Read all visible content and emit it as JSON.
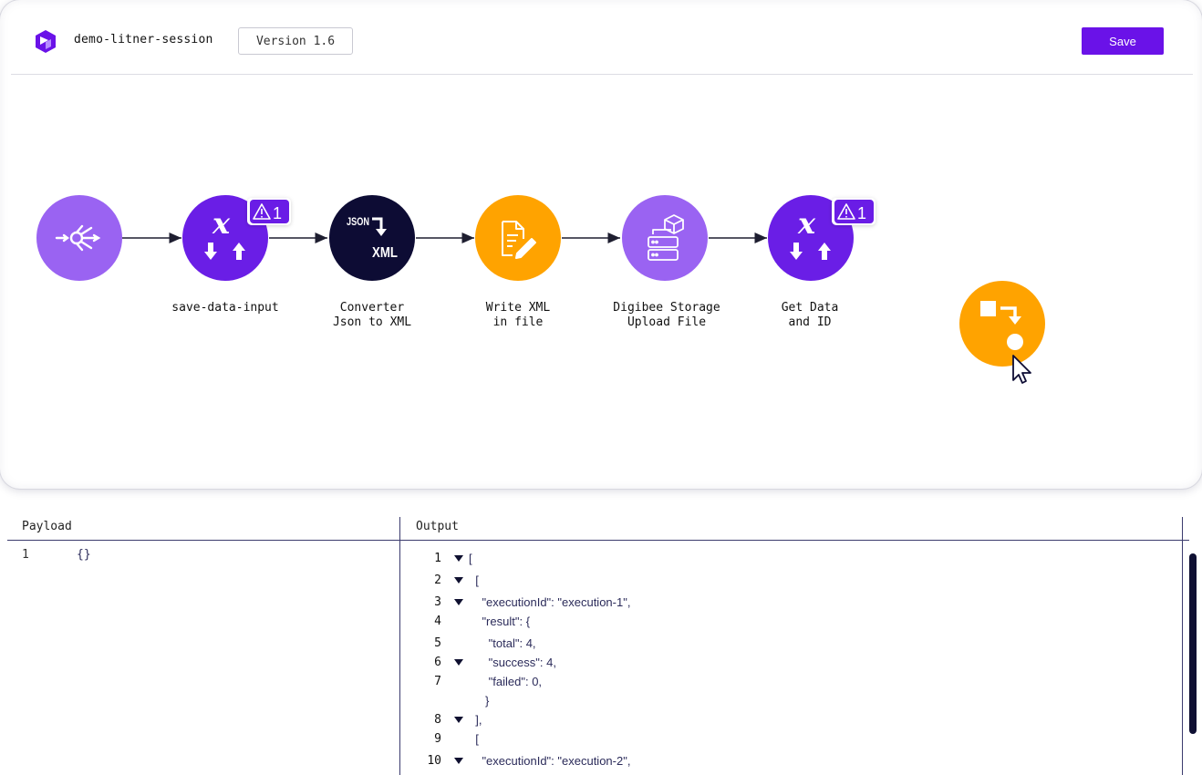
{
  "header": {
    "title": "demo-litner-session",
    "version_label": "Version 1.6",
    "save_label": "Save"
  },
  "flow": {
    "nodes": [
      {
        "id": "trigger",
        "label_line1": "",
        "label_line2": "",
        "icon": "trigger-icon",
        "color": "#9a63f2"
      },
      {
        "id": "save-data-input",
        "label_line1": "save-data-input",
        "label_line2": "",
        "icon": "transformer-icon",
        "color": "#6a1ee6",
        "warning_count": "1"
      },
      {
        "id": "converter",
        "label_line1": "Converter",
        "label_line2": "Json to XML",
        "icon": "json-to-xml-icon",
        "color": "#0d0c34",
        "icon_text_top": "JSON",
        "icon_text_bottom": "XML"
      },
      {
        "id": "write-xml",
        "label_line1": "Write XML",
        "label_line2": "in file",
        "icon": "file-edit-icon",
        "color": "#ffa300"
      },
      {
        "id": "digibee-storage",
        "label_line1": "Digibee Storage",
        "label_line2": "Upload File",
        "icon": "storage-upload-icon",
        "color": "#9a63f2"
      },
      {
        "id": "get-data",
        "label_line1": "Get Data",
        "label_line2": "and ID",
        "icon": "transformer-icon",
        "color": "#6a1ee6",
        "warning_count": "1"
      },
      {
        "id": "dragging-node",
        "label_line1": "",
        "label_line2": "",
        "icon": "flow-control-icon",
        "color": "#ffa300"
      }
    ]
  },
  "payload": {
    "title": "Payload",
    "line_number": "1",
    "content": "{}"
  },
  "output": {
    "title": "Output",
    "lines": [
      {
        "n": "1",
        "fold": true,
        "text": "["
      },
      {
        "n": "2",
        "fold": true,
        "text": "  ["
      },
      {
        "n": "3",
        "fold": true,
        "text": "    \"executionId\": \"execution-1\","
      },
      {
        "n": "4",
        "fold": false,
        "text": "    \"result\": {"
      },
      {
        "n": "5",
        "fold": false,
        "text": "      \"total\": 4,"
      },
      {
        "n": "6",
        "fold": true,
        "text": "      \"success\": 4,"
      },
      {
        "n": "7",
        "fold": false,
        "text": "      \"failed\": 0,"
      },
      {
        "n": "",
        "fold": false,
        "text": "     }"
      },
      {
        "n": "8",
        "fold": true,
        "text": "  ],"
      },
      {
        "n": "9",
        "fold": false,
        "text": "  ["
      },
      {
        "n": "10",
        "fold": true,
        "text": "    \"executionId\": \"execution-2\","
      }
    ]
  },
  "colors": {
    "accent": "#6a12e8",
    "purple_light": "#9a63f2",
    "purple_dark": "#6a1ee6",
    "navy": "#0d0c34",
    "orange": "#ffa300"
  }
}
